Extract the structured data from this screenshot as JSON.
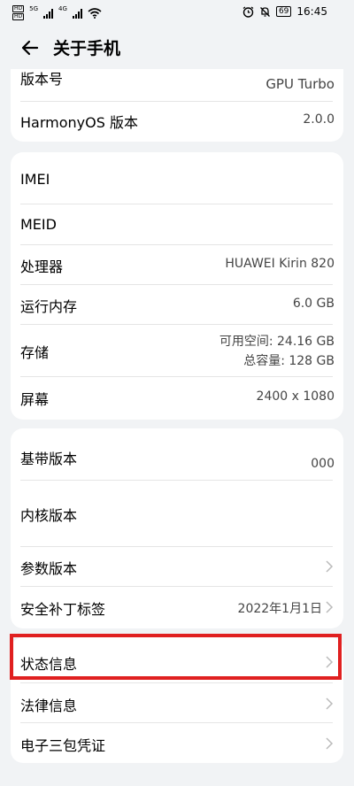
{
  "status": {
    "sim1": "HD",
    "sim2": "HD",
    "net1": "5G",
    "net2": "4G",
    "battery": "69",
    "time": "16:45"
  },
  "header": {
    "title": "关于手机"
  },
  "card1": {
    "version_label": "版本号",
    "version_value_line2": "GPU Turbo",
    "os_label": "HarmonyOS 版本",
    "os_value": "2.0.0"
  },
  "card2": {
    "imei_label": "IMEI",
    "meid_label": "MEID",
    "cpu_label": "处理器",
    "cpu_value": "HUAWEI Kirin 820",
    "ram_label": "运行内存",
    "ram_value": "6.0 GB",
    "storage_label": "存储",
    "storage_available": "可用空间:  24.16  GB",
    "storage_total": "总容量:  128  GB",
    "screen_label": "屏幕",
    "screen_value": "2400 x 1080"
  },
  "card3": {
    "baseband_label": "基带版本",
    "baseband_value": "000",
    "kernel_label": "内核版本",
    "param_label": "参数版本",
    "patch_label": "安全补丁标签",
    "patch_value": "2022年1月1日"
  },
  "card4": {
    "status_label": "状态信息",
    "legal_label": "法律信息",
    "warranty_label": "电子三包凭证"
  },
  "colors": {
    "background": "#f1f3f5",
    "card": "#ffffff",
    "highlight": "#e02020"
  }
}
